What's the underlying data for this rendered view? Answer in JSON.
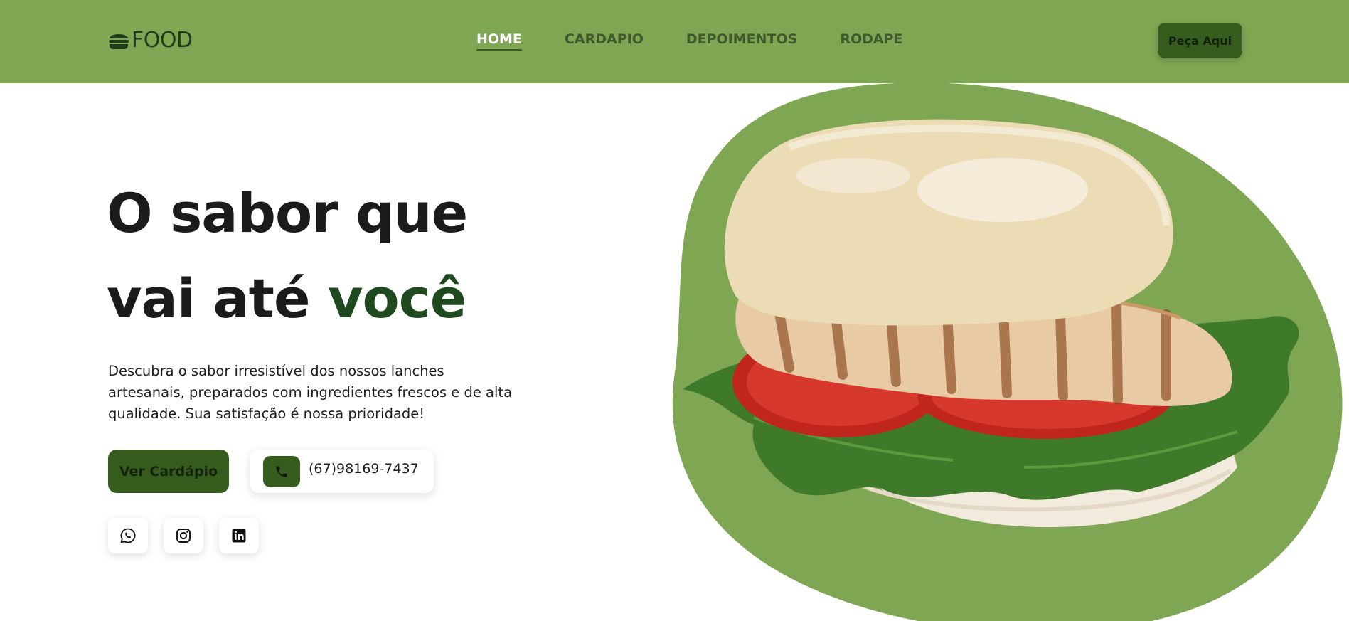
{
  "header": {
    "logo_text": "FOOD",
    "logo_icon": "burger-icon",
    "nav": [
      {
        "label": "HOME",
        "active": true
      },
      {
        "label": "CARDAPIO",
        "active": false
      },
      {
        "label": "DEPOIMENTOS",
        "active": false
      },
      {
        "label": "RODAPE",
        "active": false
      }
    ],
    "order_button": "Peça Aqui"
  },
  "hero": {
    "headline_line1": "O sabor que",
    "headline_line2_prefix": "vai até ",
    "headline_line2_accent": "você",
    "description": "Descubra o sabor irresistível dos nossos lanches artesanais, preparados com ingredientes frescos e de alta qualidade. Sua satisfação é nossa prioridade!",
    "menu_button": "Ver Cardápio",
    "phone": "(67)98169-7437",
    "phone_icon": "phone-icon",
    "socials": [
      {
        "icon": "whatsapp-icon"
      },
      {
        "icon": "instagram-icon"
      },
      {
        "icon": "linkedin-icon"
      }
    ],
    "image_subject": "grilled chicken sandwich"
  },
  "colors": {
    "header_bg": "#7fa653",
    "accent_dark": "#365d1d",
    "headline_accent": "#1f4a1f",
    "blob": "#7fa653"
  }
}
